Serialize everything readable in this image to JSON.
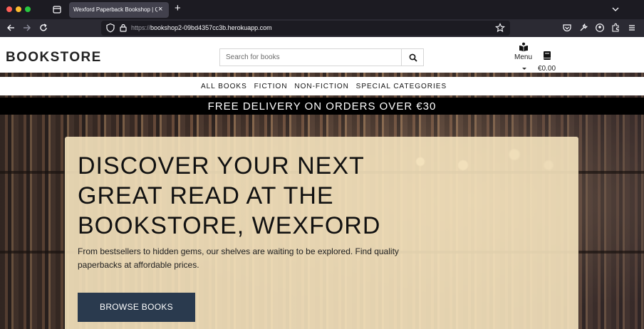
{
  "browser": {
    "tab_title": "Wexford Paperback Bookshop | Qua",
    "url_scheme": "https://",
    "url_host": "bookshop2-09bd4357cc3b.herokuapp.com"
  },
  "header": {
    "logo": "BOOKSTORE",
    "search_placeholder": "Search for books",
    "menu_label": "Menu",
    "cart_total": "€0.00"
  },
  "category_nav": {
    "items": [
      "ALL BOOKS",
      "FICTION",
      "NON-FICTION",
      "SPECIAL CATEGORIES"
    ]
  },
  "promo_banner": "FREE DELIVERY ON ORDERS OVER €30",
  "hero": {
    "title": "DISCOVER YOUR NEXT GREAT READ AT THE BOOKSTORE, WEXFORD",
    "subtitle": "From bestsellers to hidden gems, our shelves are waiting to be explored. Find quality paperbacks at affordable prices.",
    "cta_label": "BROWSE BOOKS"
  },
  "colors": {
    "promo_bg": "#000000",
    "hero_card_bg": "#f5e3be",
    "cta_bg": "#2a3a4e"
  }
}
